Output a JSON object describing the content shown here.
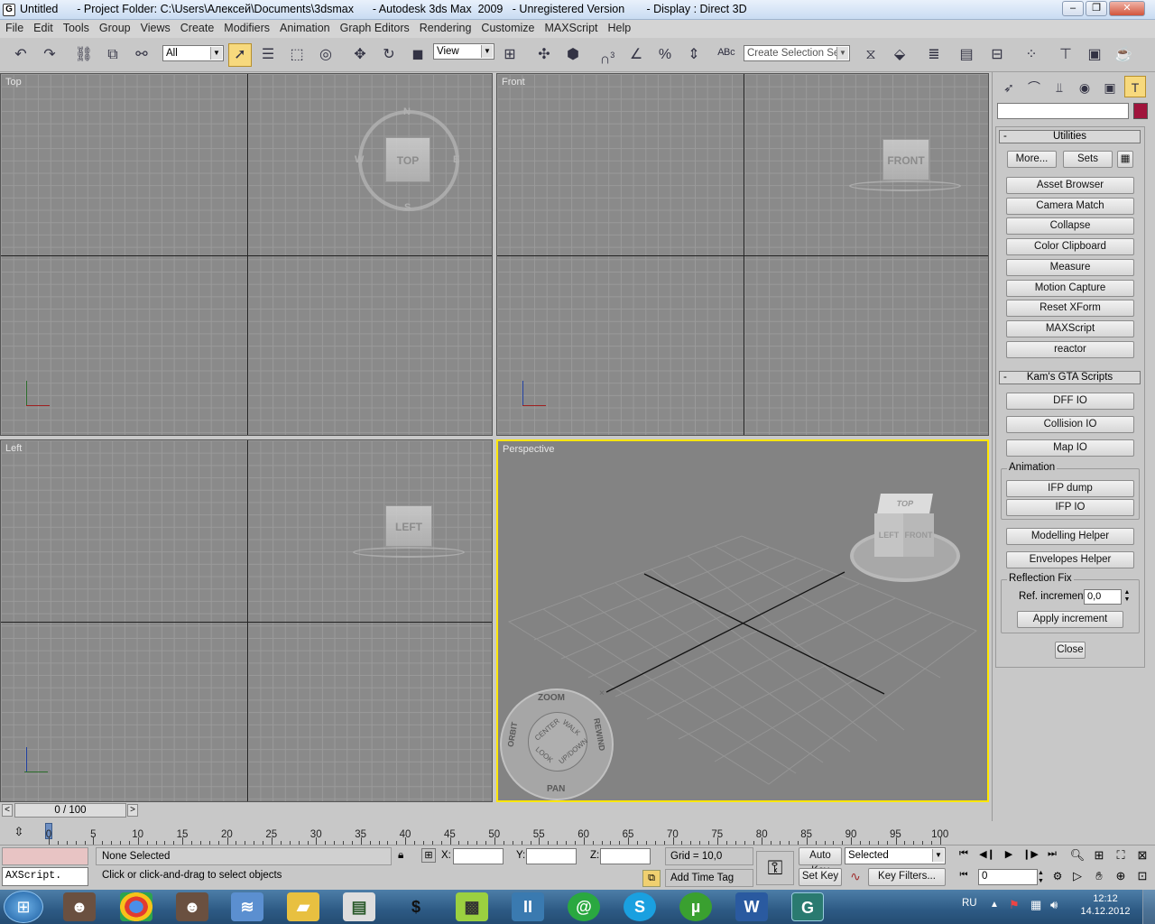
{
  "window": {
    "title": "Untitled      - Project Folder: C:\\Users\\Алексей\\Documents\\3dsmax      - Autodesk 3ds Max  2009   - Unregistered Version       - Display : Direct 3D",
    "app_icon": "G",
    "minimize": "‒",
    "maximize": "❐",
    "close": "✕"
  },
  "menu": [
    "File",
    "Edit",
    "Tools",
    "Group",
    "Views",
    "Create",
    "Modifiers",
    "Animation",
    "Graph Editors",
    "Rendering",
    "Customize",
    "MAXScript",
    "Help"
  ],
  "toolbar": {
    "selection_filter": "All",
    "ref_coord": "View",
    "named_selection_placeholder": "Create Selection Set",
    "snap_label": "3"
  },
  "viewports": {
    "top": {
      "label": "Top",
      "cube": "TOP",
      "compass": [
        "N",
        "S",
        "E",
        "W"
      ]
    },
    "front": {
      "label": "Front",
      "cube": "FRONT"
    },
    "left": {
      "label": "Left",
      "cube": "LEFT"
    },
    "perspective": {
      "label": "Perspective",
      "cube_faces": [
        "TOP",
        "LEFT",
        "FRONT"
      ]
    }
  },
  "steering_wheel": {
    "zoom": "ZOOM",
    "orbit": "ORBIT",
    "rewind": "REWIND",
    "pan": "PAN",
    "center": "CENTER",
    "walk": "WALK",
    "look": "LOOK",
    "updown": "UP/DOWN"
  },
  "command_panel": {
    "utilities": {
      "header": "Utilities",
      "collapse": "-",
      "more": "More...",
      "sets": "Sets",
      "buttons": [
        "Asset Browser",
        "Camera Match",
        "Collapse",
        "Color Clipboard",
        "Measure",
        "Motion Capture",
        "Reset XForm",
        "MAXScript",
        "reactor"
      ]
    },
    "kams": {
      "header": "Kam's GTA Scripts",
      "collapse": "-",
      "dff": "DFF IO",
      "collision": "Collision IO",
      "map": "Map IO",
      "animation_group": "Animation",
      "ifp_dump": "IFP dump",
      "ifp_io": "IFP IO",
      "modelling": "Modelling Helper",
      "envelopes": "Envelopes Helper",
      "reflection_group": "Reflection Fix",
      "ref_increment_label": "Ref. increment",
      "ref_increment_value": "0,0",
      "apply": "Apply increment",
      "close": "Close"
    }
  },
  "timeslider": {
    "label": "0 / 100",
    "left_arrow": "<",
    "right_arrow": ">"
  },
  "timeline_ticks": [
    "0",
    "5",
    "10",
    "15",
    "20",
    "25",
    "30",
    "35",
    "40",
    "45",
    "50",
    "55",
    "60",
    "65",
    "70",
    "75",
    "80",
    "85",
    "90",
    "95",
    "100"
  ],
  "status": {
    "maxscript": "AXScript.",
    "selection": "None Selected",
    "prompt": "Click or click-and-drag to select objects",
    "x_label": "X:",
    "y_label": "Y:",
    "z_label": "Z:",
    "grid": "Grid = 10,0",
    "add_time_tag": "Add Time Tag",
    "auto_key": "Auto Key",
    "set_key": "Set Key",
    "key_mode": "Selected",
    "key_filters": "Key Filters...",
    "frame": "0"
  },
  "taskbar": {
    "lang": "RU",
    "time": "12:12",
    "date": "14.12.2012"
  },
  "colors": {
    "highlight": "#f7d97d",
    "perspective_border": "#ffe600",
    "color_swatch": "#a0143c"
  }
}
